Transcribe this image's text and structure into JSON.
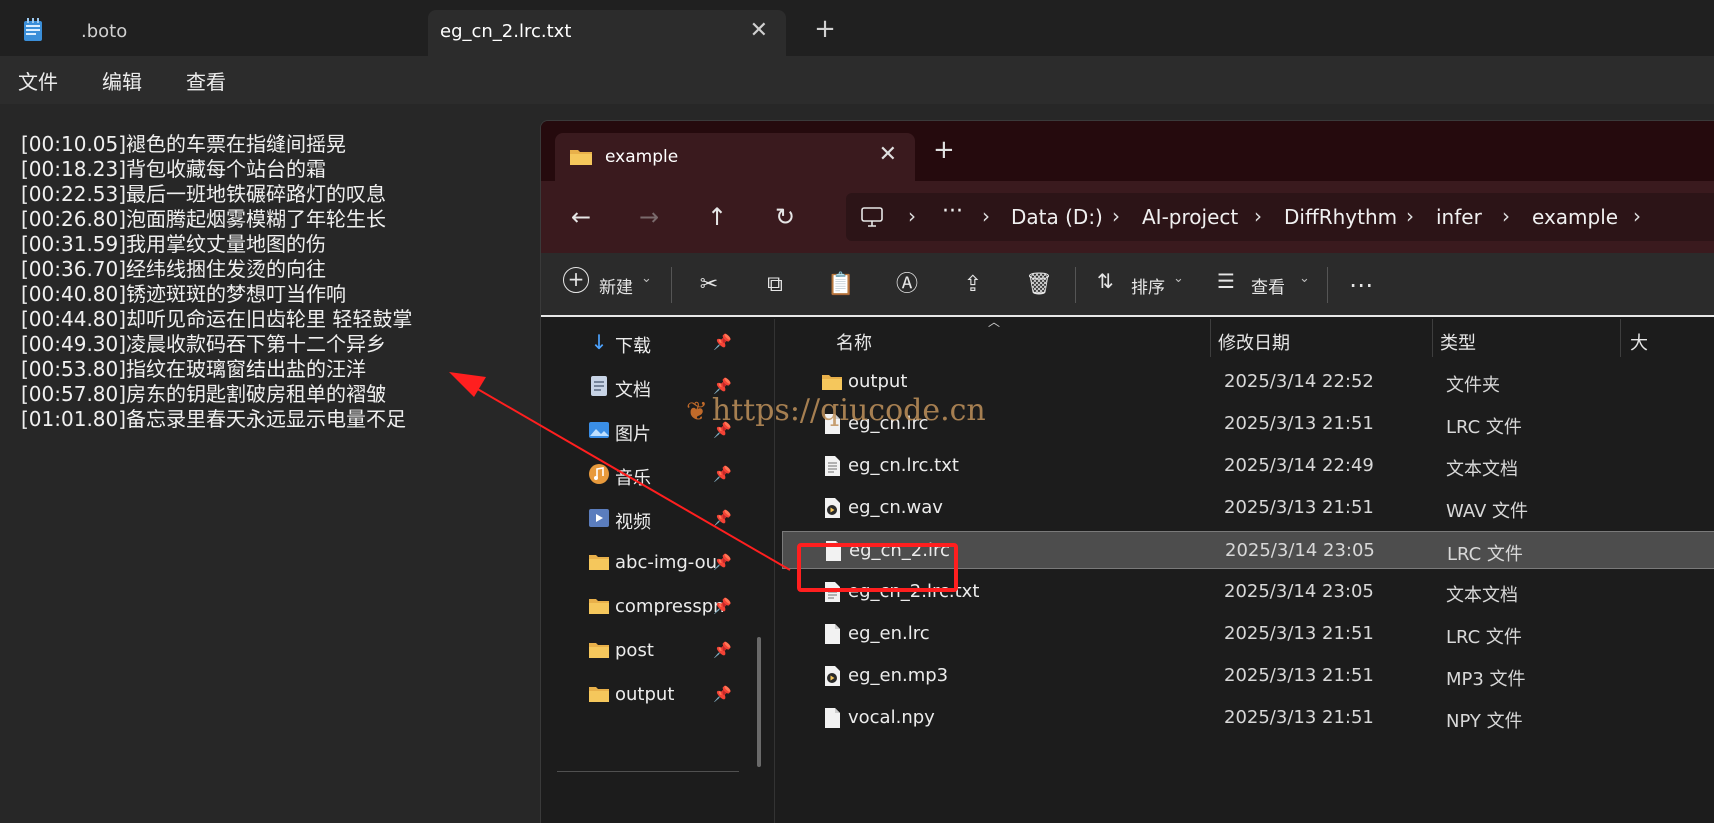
{
  "notepad": {
    "tabs": [
      ".boto",
      "eg_cn_2.lrc.txt"
    ],
    "menu": [
      "文件",
      "编辑",
      "查看"
    ],
    "lines": [
      "[00:10.05]褪色的车票在指缝间摇晃",
      "[00:18.23]背包收藏每个站台的霜",
      "[00:22.53]最后一班地铁碾碎路灯的叹息",
      "[00:26.80]泡面腾起烟雾模糊了年轮生长",
      "[00:31.59]我用掌纹丈量地图的伤",
      "[00:36.70]经纬线捆住发烫的向往",
      "[00:40.80]锈迹斑斑的梦想叮当作响",
      "[00:44.80]却听见命运在旧齿轮里 轻轻鼓掌",
      "[00:49.30]凌晨收款码吞下第十二个异乡",
      "[00:53.80]指纹在玻璃窗结出盐的汪洋",
      "[00:57.80]房东的钥匙割破房租单的褶皱",
      "[01:01.80]备忘录里春天永远显示电量不足"
    ]
  },
  "explorer": {
    "tab_title": "example",
    "breadcrumb": [
      "Data (D:)",
      "AI-project",
      "DiffRhythm",
      "infer",
      "example"
    ],
    "toolbar": {
      "new_label": "新建",
      "sort_label": "排序",
      "view_label": "查看"
    },
    "sidebar": [
      {
        "label": "下载",
        "icon": "download-icon"
      },
      {
        "label": "文档",
        "icon": "document-icon"
      },
      {
        "label": "图片",
        "icon": "picture-icon"
      },
      {
        "label": "音乐",
        "icon": "music-icon"
      },
      {
        "label": "视频",
        "icon": "video-icon"
      },
      {
        "label": "abc-img-ou",
        "icon": "folder-icon"
      },
      {
        "label": "compresspn",
        "icon": "folder-icon"
      },
      {
        "label": "post",
        "icon": "folder-icon"
      },
      {
        "label": "output",
        "icon": "folder-icon"
      }
    ],
    "columns": [
      "名称",
      "修改日期",
      "类型",
      "大"
    ],
    "files": [
      {
        "name": "output",
        "date": "2025/3/14 22:52",
        "type": "文件夹",
        "icon": "folder-icon"
      },
      {
        "name": "eg_cn.lrc",
        "date": "2025/3/13 21:51",
        "type": "LRC 文件",
        "icon": "file-icon"
      },
      {
        "name": "eg_cn.lrc.txt",
        "date": "2025/3/14 22:49",
        "type": "文本文档",
        "icon": "text-file-icon"
      },
      {
        "name": "eg_cn.wav",
        "date": "2025/3/13 21:51",
        "type": "WAV 文件",
        "icon": "audio-file-icon"
      },
      {
        "name": "eg_cn_2.lrc",
        "date": "2025/3/14 23:05",
        "type": "LRC 文件",
        "icon": "file-icon",
        "selected": true
      },
      {
        "name": "eg_cn_2.lrc.txt",
        "date": "2025/3/14 23:05",
        "type": "文本文档",
        "icon": "text-file-icon"
      },
      {
        "name": "eg_en.lrc",
        "date": "2025/3/13 21:51",
        "type": "LRC 文件",
        "icon": "file-icon"
      },
      {
        "name": "eg_en.mp3",
        "date": "2025/3/13 21:51",
        "type": "MP3 文件",
        "icon": "audio-file-icon"
      },
      {
        "name": "vocal.npy",
        "date": "2025/3/13 21:51",
        "type": "NPY 文件",
        "icon": "file-icon"
      }
    ]
  },
  "watermark": "https://qiucode.cn",
  "colors": {
    "annotation": "#ff1f1f",
    "explorer_titlebar": "#3a1a1e",
    "folder": "#e8b04a"
  }
}
